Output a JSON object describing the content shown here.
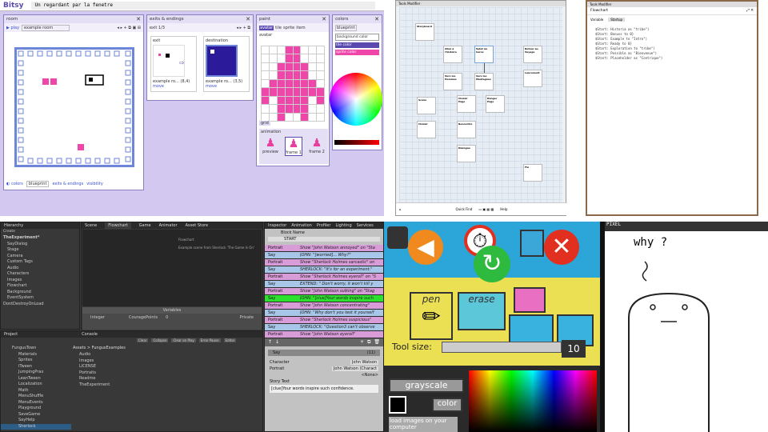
{
  "bitsy": {
    "logo": "Bitsy",
    "title": "Un regardant par la fenetre",
    "room": {
      "header": "room",
      "play": "play",
      "name": "example room",
      "colors_label": "colors",
      "palette": "blueprint",
      "exits_label": "exits & endings",
      "visibility": "visibility"
    },
    "exits": {
      "header": "exits & endings",
      "exit_label": "exit 1/3",
      "exit_title": "exit",
      "dest_title": "destination",
      "exit_room": "example ro... (8,4)",
      "dest_room": "example ro... (3,5)",
      "move": "move"
    },
    "paint": {
      "header": "paint",
      "tabs": [
        "avatar",
        "tile",
        "sprite",
        "item"
      ],
      "name": "avatar",
      "grid": "grid",
      "animation": "animation",
      "frames": [
        "preview",
        "frame 1",
        "frame 2"
      ]
    },
    "colors": {
      "header": "colors",
      "palette": "blueprint",
      "background": "background color",
      "tile": "tile color",
      "sprite": "sprite color"
    }
  },
  "flowchart": {
    "menu": "Tools  Modifier",
    "nodes": [
      "Storyboard",
      "Allez à l'histoire",
      "Salut au héros",
      "Retour au Voyage",
      "Vers les Hommes",
      "Vers les Montagnes",
      "Lancement",
      "Scène",
      "Choisir Page",
      "Danger Page",
      "Choisir",
      "Rencontre",
      "Dialogue",
      "Fin"
    ],
    "footer": [
      "Quick Find",
      "Help"
    ]
  },
  "code": {
    "menu": "Tools  Modifier",
    "title": "Flowchart",
    "tabs": [
      "Variable",
      "Startup"
    ],
    "lines": [
      "$Start: Historia as \"tribe\")",
      "$Start: Bonuss to 0}",
      "$Start: Example to \"Intro\")",
      "$Start: Ready to 0}",
      "$Start: Exploration to \"tribe\")",
      "$Start: Possible as \"Bienvenue\")",
      "$Start: Placeholder as \"Contrique\")"
    ]
  },
  "unity": {
    "tabs": {
      "hierarchy": "Hierarchy",
      "scene": "Scene",
      "flowchart": "Flowchart",
      "game": "Game",
      "animator": "Animator",
      "asset_store": "Asset Store",
      "inspector": "Inspector",
      "animation": "Animation",
      "profiler": "Profiler",
      "lighting": "Lighting",
      "services": "Services",
      "project": "Project",
      "console": "Console"
    },
    "hierarchy_root": "TheExperiment*",
    "hierarchy_items": [
      "SayDialog",
      "Stage",
      "Camera",
      "Custom Tags",
      "Audio",
      "Characters",
      "Images",
      "Flowchart",
      "Background",
      "EventSystem"
    ],
    "hierarchy_extra": "DontDestroyOnLoad",
    "flowchart_desc": "Example scene from Sherlock 'The Game Is On'",
    "flowchart_name": "Flowchart",
    "variables_label": "Variables",
    "variable": {
      "type": "Integer",
      "name": "CouragePoints",
      "value": "0",
      "scope": "Private"
    },
    "block_name_label": "Block Name",
    "block_name": "START",
    "commands": [
      {
        "k": "Portrait",
        "v": "Show \"John Watson annoyed\" on \"Sta",
        "c": "#d89cd8"
      },
      {
        "k": "Say",
        "v": "JOHN: \"[worried]... Why?\"",
        "c": "#a7c6e8"
      },
      {
        "k": "Portrait",
        "v": "Show \"Sherlock Holmes sarcastic\" on",
        "c": "#d89cd8"
      },
      {
        "k": "Say",
        "v": "SHERLOCK: \"It's for an experiment.\"",
        "c": "#a7c6e8"
      },
      {
        "k": "Portrait",
        "v": "Show \"Sherlock Holmes eyeroll\" on \"S",
        "c": "#d89cd8"
      },
      {
        "k": "Say",
        "v": "EXTEND: \" Don't worry, it won't kill y",
        "c": "#a7c6e8"
      },
      {
        "k": "Portrait",
        "v": "Show \"John Watson sulking\" on \"Stag",
        "c": "#d89cd8"
      },
      {
        "k": "Say",
        "v": "JOHN: \"[clue]Your words inspire such",
        "c": "#2ee02e"
      },
      {
        "k": "Portrait",
        "v": "Show \"John Watson concentrating\"",
        "c": "#d89cd8"
      },
      {
        "k": "Say",
        "v": "JOHN: \"Why don't you test it yourself",
        "c": "#a7c6e8"
      },
      {
        "k": "Portrait",
        "v": "Show \"Sherlock Holmes suspicious\"",
        "c": "#d89cd8"
      },
      {
        "k": "Say",
        "v": "SHERLOCK: \"Question3 can't observe",
        "c": "#a7c6e8"
      },
      {
        "k": "Portrait",
        "v": "Show \"John Watson eyeroll\"",
        "c": "#d89cd8"
      }
    ],
    "say_header": "Say",
    "say_index": "(11)",
    "character_label": "Character",
    "character_value": "John Watson",
    "portrait_label": "Portrait",
    "portrait_value": "John Watson (Charact",
    "portrait_sub": "<None>",
    "story_label": "Story Text",
    "story_text": "[clue]Your words inspire such confidence.",
    "project_breadcrumb": "Assets > FungusExamples",
    "project_tree": [
      "FungusTown",
      "Materials",
      "Sprites",
      "iTween",
      "JumpingPrax",
      "LeanTween",
      "Localization",
      "Math",
      "MenuShuffle",
      "MenuEvents",
      "Playground",
      "SaveGame",
      "SayHelp",
      "Sherlock"
    ],
    "project_files": [
      "Audio",
      "Images",
      "LICENSE",
      "Portraits",
      "Readme",
      "TheExperiment"
    ],
    "console_buttons": [
      "Clear",
      "Collapse",
      "Clear on Play",
      "Error Pause",
      "Editor"
    ],
    "create_label": "Create"
  },
  "paintapp": {
    "pen": "pen",
    "erase": "erase",
    "tool_size": "Tool size:",
    "size_value": "10",
    "grayscale": "grayscale",
    "color": "color",
    "load_images": "load images on your computer",
    "canvas_label": "PIXEL",
    "doodle_text": "why ?",
    "colors": {
      "panel": "#ebe053",
      "orange": "#f18a1e",
      "green": "#2dba3e",
      "red": "#e23020"
    }
  }
}
